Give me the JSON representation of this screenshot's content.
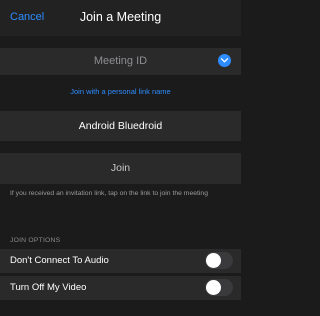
{
  "header": {
    "cancel_label": "Cancel",
    "title": "Join a Meeting"
  },
  "meeting_id": {
    "placeholder": "Meeting ID"
  },
  "link_name_label": "Join with a personal link name",
  "display_name": {
    "value": "Android Bluedroid"
  },
  "join_button_label": "Join",
  "hint_text": "If you received an invitation link, tap on the link to join the meeting",
  "join_options": {
    "section_title": "JOIN OPTIONS",
    "options": [
      {
        "label": "Don't Connect To Audio",
        "enabled": false
      },
      {
        "label": "Turn Off My Video",
        "enabled": false
      }
    ]
  },
  "colors": {
    "accent": "#2d8cff",
    "background": "#1b1b1b",
    "row": "#2a2a2a"
  }
}
